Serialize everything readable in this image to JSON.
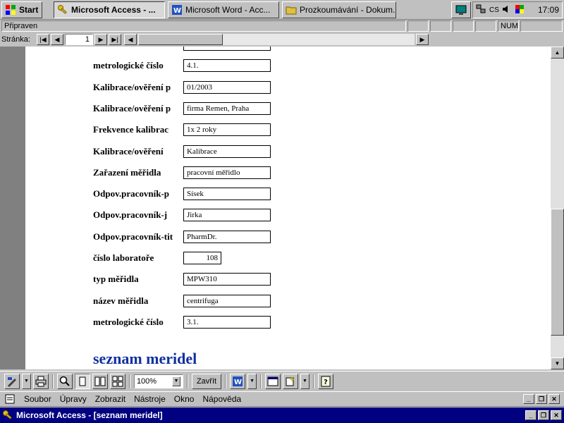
{
  "taskbar": {
    "start_label": "Start",
    "buttons": [
      {
        "label": "Microsoft Access - ...",
        "active": true
      },
      {
        "label": "Microsoft Word - Acc...",
        "active": false
      },
      {
        "label": "Prozkoumávání - Dokum...",
        "active": false
      }
    ],
    "clock": "17:09",
    "tray_language": "CS"
  },
  "statusbar": {
    "status": "Připraven",
    "num": "NUM"
  },
  "navigator": {
    "label": "Stránka:",
    "page_value": "1"
  },
  "report": {
    "title": "seznam meridel",
    "rows": [
      {
        "label": "",
        "value": ""
      },
      {
        "label": "metrologické číslo",
        "value": "4.1."
      },
      {
        "label": "Kalibrace/ověření p",
        "value": "01/2003"
      },
      {
        "label": "Kalibrace/ověření p",
        "value": "firma Remen, Praha"
      },
      {
        "label": "Frekvence kalibrac",
        "value": "1x 2 roky"
      },
      {
        "label": "Kalibrace/ověření",
        "value": "Kalibrace"
      },
      {
        "label": "Zařazení měřidla",
        "value": "pracovní měřidlo"
      },
      {
        "label": "Odpov.pracovník-p",
        "value": "Sísek"
      },
      {
        "label": "Odpov.pracovník-j",
        "value": "Jirka"
      },
      {
        "label": "Odpov.pracovník-tit",
        "value": "PharmDr."
      },
      {
        "label": "číslo laboratoře",
        "value": "108"
      },
      {
        "label": "typ měřidla",
        "value": "MPW310"
      },
      {
        "label": "název měřidla",
        "value": "centrifuga"
      },
      {
        "label": "metrologické číslo",
        "value": "3.1."
      }
    ]
  },
  "toolbar": {
    "zoom_value": "100%",
    "close_label": "Zavřít"
  },
  "menu": {
    "items": [
      "Soubor",
      "Úpravy",
      "Zobrazit",
      "Nástroje",
      "Okno",
      "Nápověda"
    ]
  },
  "window": {
    "title": "Microsoft Access - [seznam meridel]"
  },
  "colors": {
    "titlebar": "#000080",
    "report_title": "#1030a0",
    "face": "#c0c0c0"
  }
}
